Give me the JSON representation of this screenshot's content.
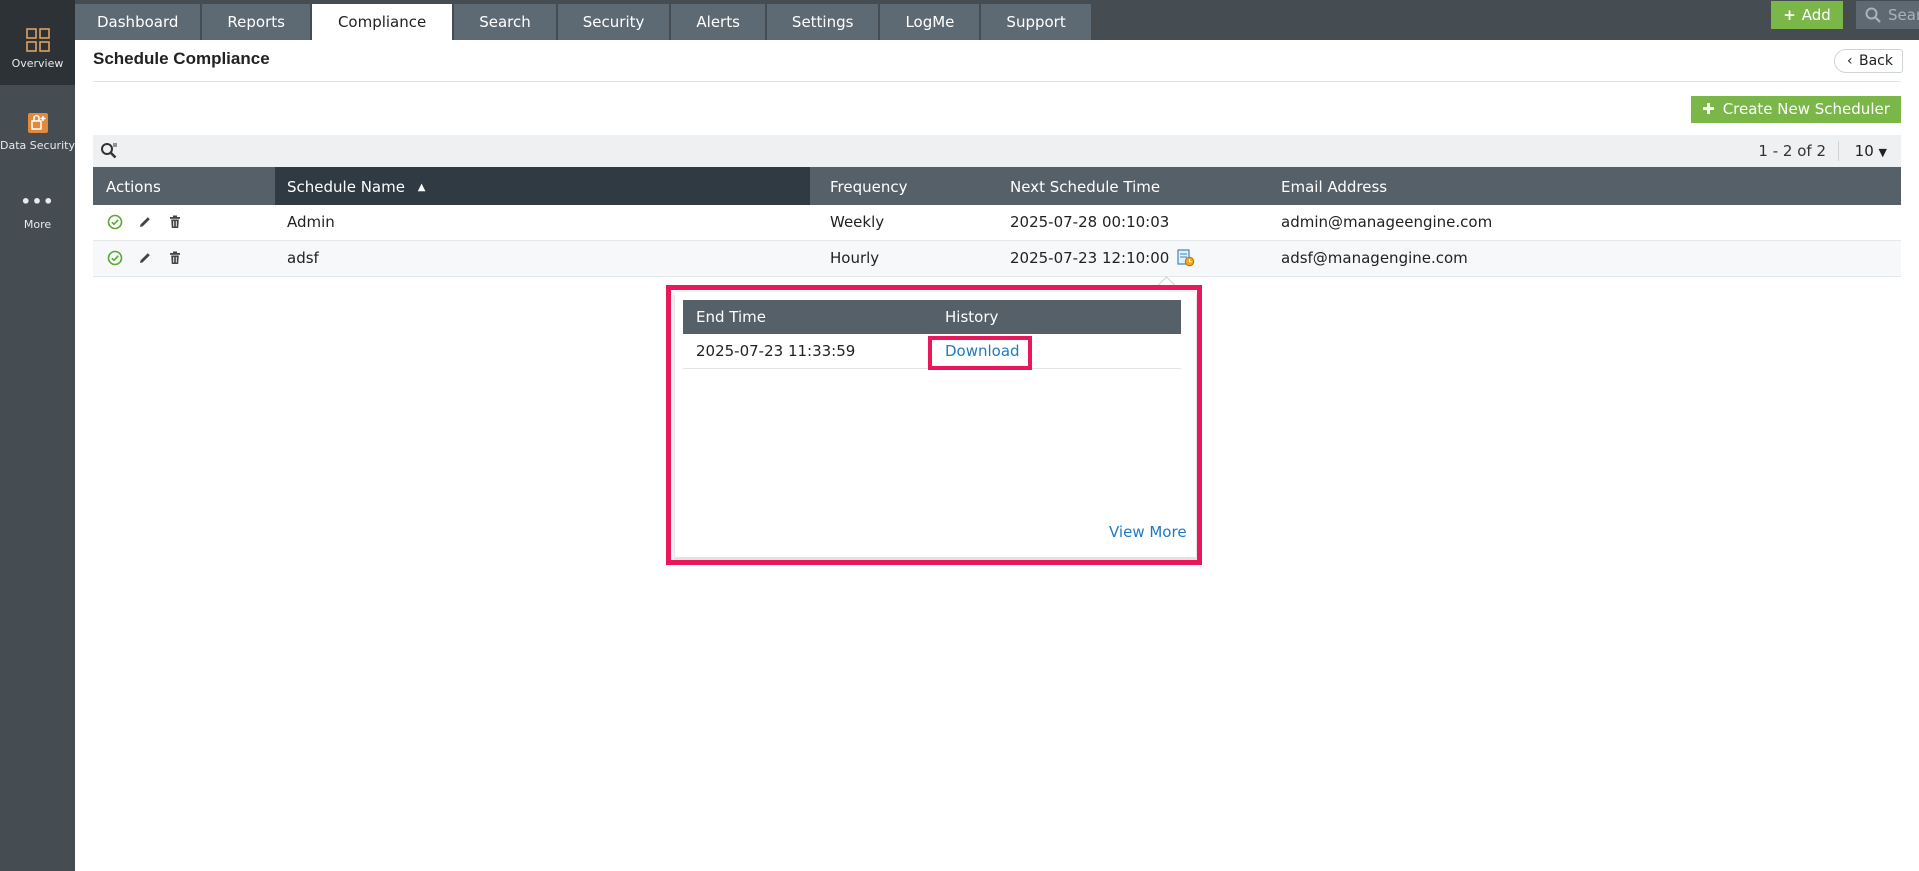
{
  "rail": {
    "items": [
      {
        "label": "Overview",
        "icon": "grid-icon"
      },
      {
        "label": "Data Security",
        "icon": "data-security-icon"
      },
      {
        "label": "More",
        "icon": "more-dots-icon"
      }
    ]
  },
  "nav": {
    "tabs": [
      {
        "label": "Dashboard"
      },
      {
        "label": "Reports"
      },
      {
        "label": "Compliance",
        "active": true
      },
      {
        "label": "Search"
      },
      {
        "label": "Security"
      },
      {
        "label": "Alerts"
      },
      {
        "label": "Settings"
      },
      {
        "label": "LogMe"
      },
      {
        "label": "Support"
      }
    ],
    "add_label": "Add",
    "search_placeholder": "Search"
  },
  "page": {
    "title": "Schedule Compliance",
    "back_label": "Back",
    "create_label": "Create New Scheduler"
  },
  "toolbar": {
    "pager": "1 - 2 of 2",
    "page_size": "10"
  },
  "grid": {
    "columns": [
      "Actions",
      "Schedule Name",
      "Frequency",
      "Next Schedule Time",
      "Email Address"
    ],
    "sorted_column": "Schedule Name",
    "sort_direction": "asc",
    "rows": [
      {
        "name": "Admin",
        "frequency": "Weekly",
        "next_time": "2025-07-28 00:10:03",
        "email": "admin@manageengine.com"
      },
      {
        "name": "adsf",
        "frequency": "Hourly",
        "next_time": "2025-07-23 12:10:00",
        "email": "adsf@managengine.com"
      }
    ]
  },
  "popover": {
    "columns": [
      "End Time",
      "History"
    ],
    "rows": [
      {
        "end_time": "2025-07-23 11:33:59",
        "history": "Download"
      }
    ],
    "view_more": "View More"
  },
  "colors": {
    "accent_green": "#7ab648",
    "nav_bg": "#454c52",
    "highlight": "#e8185a",
    "link": "#1f7bc1"
  }
}
